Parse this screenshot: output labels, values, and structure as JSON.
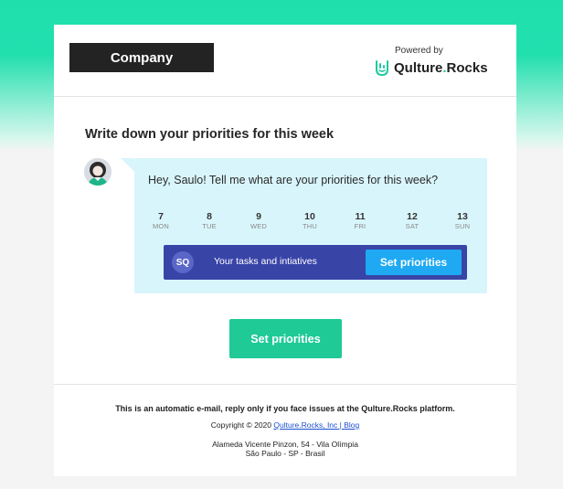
{
  "header": {
    "company_logo": "Company",
    "powered_by": "Powered by",
    "brand_name": "Qulture",
    "brand_dot": ".",
    "brand_suffix": "Rocks"
  },
  "main": {
    "title": "Write down your priorities for this week",
    "greeting": "Hey, Saulo! Tell me what are your priorities for this week?",
    "days": [
      {
        "num": "7",
        "dow": "MON"
      },
      {
        "num": "8",
        "dow": "TUE"
      },
      {
        "num": "9",
        "dow": "WED"
      },
      {
        "num": "10",
        "dow": "THU"
      },
      {
        "num": "11",
        "dow": "FRI"
      },
      {
        "num": "12",
        "dow": "SAT"
      },
      {
        "num": "13",
        "dow": "SUN"
      }
    ],
    "task_bar": {
      "initials": "SQ",
      "label": "Your tasks and intiatives",
      "button": "Set priorities"
    },
    "cta_button": "Set priorities"
  },
  "footer": {
    "note": "This is an automatic e-mail, reply only if you face issues at the Qulture.Rocks platform.",
    "copyright_prefix": "Copyright © 2020 ",
    "link_company": "Qulture.Rocks, Inc",
    "separator": " | ",
    "link_blog": "Blog",
    "address_line1": "Alameda Vicente Pinzon, 54 - Vila Olímpia",
    "address_line2": "São Paulo - SP - Brasil"
  },
  "colors": {
    "accent_green": "#1fca97",
    "bubble_bg": "#d9f5fc",
    "task_bar_bg": "#3944a7",
    "button_blue": "#1ea9f2"
  }
}
